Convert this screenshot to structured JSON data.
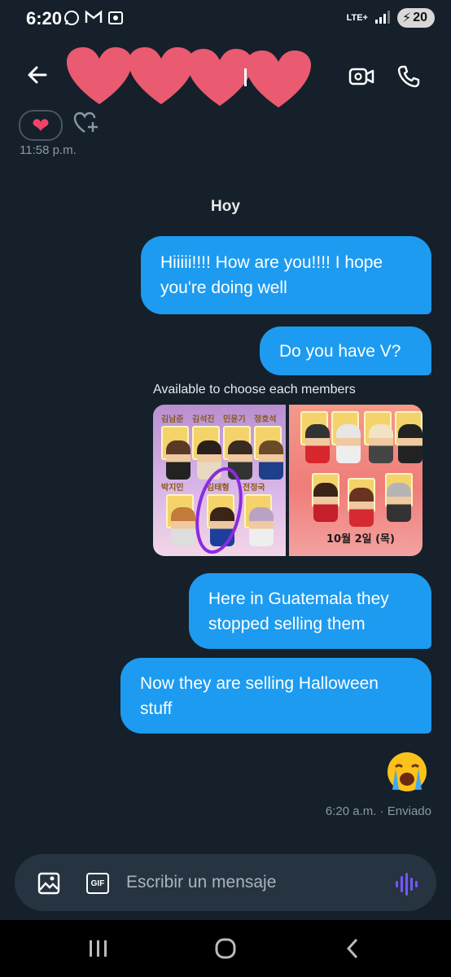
{
  "status": {
    "time": "6:20",
    "icons": [
      "whatsapp-icon",
      "gmail-icon",
      "screenshot-icon"
    ],
    "network": "LTE+",
    "battery": "20"
  },
  "header": {
    "back_icon": "arrow-left-icon",
    "video_icon": "video-call-icon",
    "phone_icon": "phone-icon"
  },
  "reaction": {
    "emoji": "❤",
    "add_icon": "heart-plus-icon",
    "time": "11:58 p.m."
  },
  "day_divider": "Hoy",
  "messages": [
    {
      "text": "Hiiiii!!!! How are you!!!! I hope you're doing well"
    },
    {
      "text": "Do you have V?"
    }
  ],
  "media": {
    "caption": "Available to choose each members",
    "left_labels": [
      "김남준",
      "김석진",
      "민윤기",
      "정호석",
      "박지민",
      "김태형",
      "전정국"
    ],
    "right_label": "10월 2일 (목)"
  },
  "messages2": [
    {
      "text": "Here in Guatemala they stopped selling them"
    },
    {
      "text": "Now they are selling Halloween stuff"
    }
  ],
  "last": {
    "emoji": "😭",
    "status": "6:20 a.m. · Enviado"
  },
  "composer": {
    "placeholder": "Escribir un mensaje",
    "gif_label": "GIF"
  },
  "colors": {
    "background": "#15202b",
    "bubble": "#1d9bf0",
    "accent_voice": "#7856ff"
  }
}
